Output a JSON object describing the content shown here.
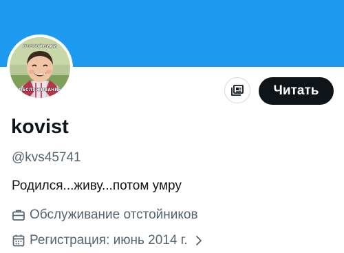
{
  "profile": {
    "name": "kovist",
    "handle": "@kvs45741",
    "bio": "Родился...живу...потом умру",
    "profession": "Обслуживание отстойников",
    "joined": "Регистрация: июнь 2014 г."
  },
  "avatar": {
    "caption_top": "ОТСТОЙНИКИ",
    "caption_bottom": "ОБСЛУЖИВАНИЕ"
  },
  "actions": {
    "follow_label": "Читать",
    "subscribe_icon": "newsletter-icon"
  },
  "icons": {
    "profession": "briefcase-icon",
    "joined": "calendar-icon",
    "expand": "chevron-right-icon"
  },
  "colors": {
    "banner": "#1d9bf0",
    "follow_button": "#0f1419",
    "secondary_text": "#536471",
    "primary_text": "#0f1419"
  }
}
